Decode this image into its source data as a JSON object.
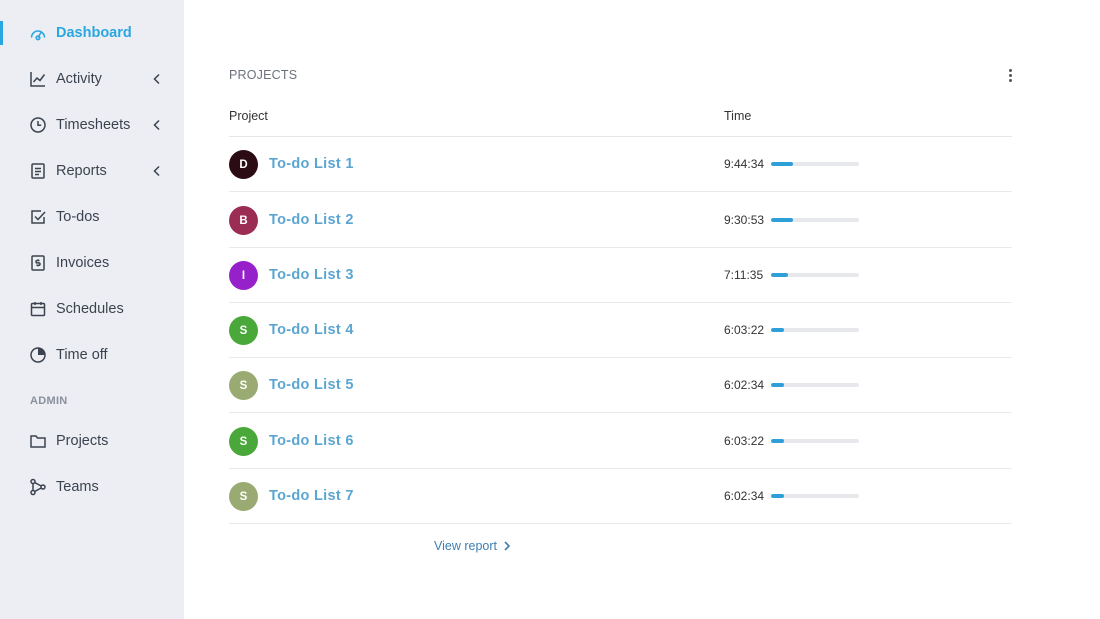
{
  "sidebar": {
    "items": [
      {
        "key": "dashboard",
        "label": "Dashboard",
        "icon": "dashboard-icon",
        "active": true,
        "chevron": false
      },
      {
        "key": "activity",
        "label": "Activity",
        "icon": "activity-chart-icon",
        "active": false,
        "chevron": true
      },
      {
        "key": "timesheets",
        "label": "Timesheets",
        "icon": "clock-icon",
        "active": false,
        "chevron": true
      },
      {
        "key": "reports",
        "label": "Reports",
        "icon": "report-icon",
        "active": false,
        "chevron": true
      },
      {
        "key": "todos",
        "label": "To-dos",
        "icon": "checkbox-icon",
        "active": false,
        "chevron": false
      },
      {
        "key": "invoices",
        "label": "Invoices",
        "icon": "invoice-icon",
        "active": false,
        "chevron": false
      },
      {
        "key": "schedules",
        "label": "Schedules",
        "icon": "calendar-icon",
        "active": false,
        "chevron": false
      },
      {
        "key": "timeoff",
        "label": "Time off",
        "icon": "pie-icon",
        "active": false,
        "chevron": false
      }
    ],
    "admin_label": "ADMIN",
    "admin_items": [
      {
        "key": "projects",
        "label": "Projects",
        "icon": "folder-icon"
      },
      {
        "key": "teams",
        "label": "Teams",
        "icon": "network-icon"
      }
    ],
    "accent_color": "#2aa7e0"
  },
  "panel": {
    "title": "PROJECTS",
    "col_project": "Project",
    "col_time": "Time",
    "view_report": "View report",
    "rows": [
      {
        "initial": "D",
        "color": "#2b0b14",
        "name": "To-do List 1",
        "time": "9:44:34",
        "progress": 0.25
      },
      {
        "initial": "B",
        "color": "#9b2d55",
        "name": "To-do List 2",
        "time": "9:30:53",
        "progress": 0.25
      },
      {
        "initial": "I",
        "color": "#9620c9",
        "name": "To-do List 3",
        "time": "7:11:35",
        "progress": 0.19
      },
      {
        "initial": "S",
        "color": "#4aa83a",
        "name": "To-do List 4",
        "time": "6:03:22",
        "progress": 0.15
      },
      {
        "initial": "S",
        "color": "#99ab72",
        "name": "To-do List 5",
        "time": "6:02:34",
        "progress": 0.15
      },
      {
        "initial": "S",
        "color": "#4aa83a",
        "name": "To-do List 6",
        "time": "6:03:22",
        "progress": 0.15
      },
      {
        "initial": "S",
        "color": "#99ab72",
        "name": "To-do List 7",
        "time": "6:02:34",
        "progress": 0.15
      }
    ]
  }
}
